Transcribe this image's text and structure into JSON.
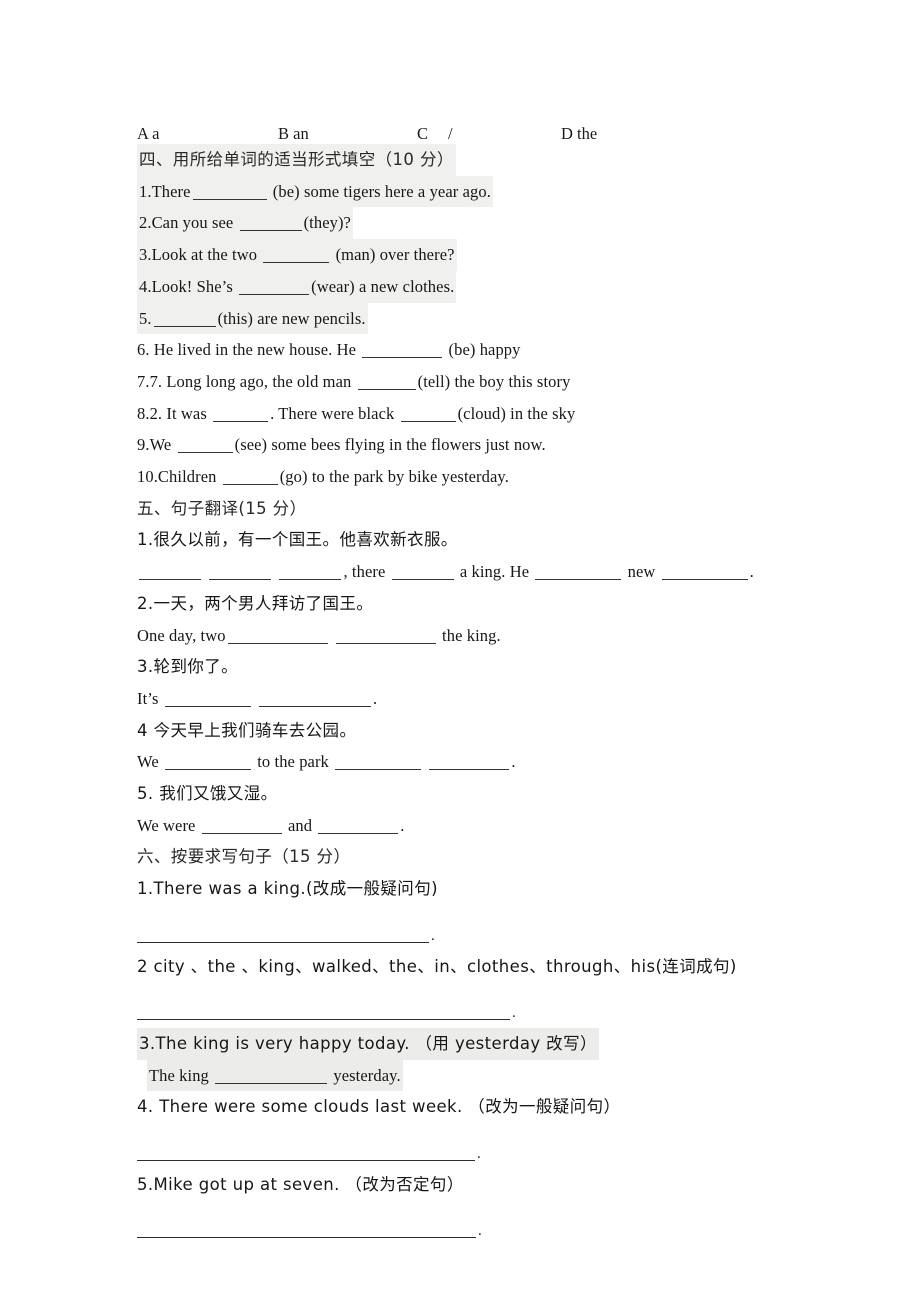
{
  "document": {
    "type": "exam-worksheet",
    "language": "zh-CN / en",
    "options_row": {
      "a": "A a",
      "b": "B an",
      "c": "C",
      "c_value": "/",
      "d": "D the"
    },
    "sections": [
      {
        "id": "section-four",
        "heading": "四、用所给单词的适当形式填空（10 分）",
        "items": [
          {
            "num": "1.There",
            "tail": "(be) some tigers here a year ago."
          },
          {
            "num": "2.Can you see",
            "tail": "(they)?"
          },
          {
            "num": "3.Look at the two",
            "tail": "(man) over there?"
          },
          {
            "num": "4.Look! She’s",
            "tail": "(wear) a new clothes."
          },
          {
            "num": "5.",
            "tail": "(this) are new pencils."
          },
          {
            "num": "6. He lived in the new house. He",
            "tail": "(be) happy"
          },
          {
            "num": "7.7. Long long ago, the old man",
            "tail": "(tell) the boy this story"
          },
          {
            "num": "8.2. It was",
            "mid": ". There were black",
            "tail": "(cloud) in the sky"
          },
          {
            "num": "9.We",
            "tail": "(see) some bees flying in the flowers just now."
          },
          {
            "num": "10.Children",
            "tail": "(go) to the park by bike yesterday."
          }
        ]
      },
      {
        "id": "section-five",
        "heading": "五、句子翻译(15 分）",
        "items": [
          {
            "prompt": "1.很久以前，有一个国王。他喜欢新衣服。",
            "answer_pre": "",
            "answer_mid1": ", there",
            "answer_mid2": "a king. He",
            "answer_mid3": "new",
            "answer_end": "."
          },
          {
            "prompt": "2.一天，两个男人拜访了国王。",
            "answer_pre": "One day, two",
            "answer_end": "the king."
          },
          {
            "prompt": "3.轮到你了。",
            "answer_pre": "It’s",
            "answer_end": "."
          },
          {
            "prompt": "4  今天早上我们骑车去公园。",
            "answer_pre": "We",
            "answer_mid1": "to the park",
            "answer_end": "."
          },
          {
            "prompt": "5. 我们又饿又湿。",
            "answer_pre": "We were",
            "answer_mid1": "and",
            "answer_end": "."
          }
        ]
      },
      {
        "id": "section-six",
        "heading": "六、按要求写句子（15 分）",
        "items": [
          {
            "prompt": "1.There was a king.(改成一般疑问句)",
            "rule_end": "."
          },
          {
            "prompt": "2 city 、the 、king、walked、the、in、clothes、through、his(连词成句)",
            "rule_end": "."
          },
          {
            "prompt": "3.The king is very happy today. （用 yesterday 改写）",
            "answer_pre": "The king",
            "answer_end": "yesterday."
          },
          {
            "prompt": "4. There were some clouds last week. （改为一般疑问句）",
            "rule_end": "."
          },
          {
            "prompt": "5.Mike got up at seven. （改为否定句）",
            "rule_end": "."
          }
        ]
      }
    ]
  }
}
